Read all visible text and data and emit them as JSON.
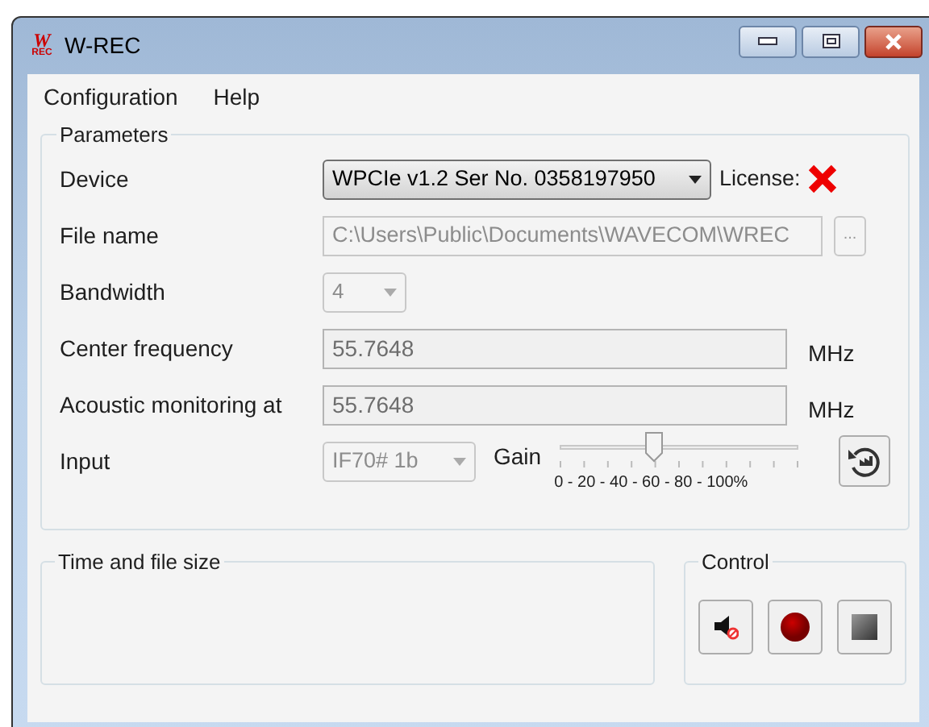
{
  "window": {
    "title": "W-REC",
    "logo": {
      "top": "W",
      "bottom": "REC"
    }
  },
  "menu": [
    {
      "label": "Configuration"
    },
    {
      "label": "Help"
    }
  ],
  "parameters": {
    "title": "Parameters",
    "rows": [
      {
        "kind": "device",
        "label": "Device",
        "value": "WPCIe v1.2 Ser No. 0358197950",
        "license_label": "License:",
        "licensed": false,
        "disabled": false
      },
      {
        "kind": "file",
        "label": "File name",
        "value": "C:\\Users\\Public\\Documents\\WAVECOM\\WREC",
        "browse": "...",
        "disabled": true
      },
      {
        "kind": "combo",
        "label": "Bandwidth",
        "value": "4",
        "disabled": true
      },
      {
        "kind": "number",
        "label": "Center frequency",
        "value": "55.7648",
        "unit": "MHz",
        "disabled": false
      },
      {
        "kind": "number",
        "label": "Acoustic monitoring at",
        "value": "55.7648",
        "unit": "MHz",
        "disabled": false
      },
      {
        "kind": "input",
        "label": "Input",
        "value": "IF70# 1b",
        "disabled": true,
        "gain_label": "Gain",
        "gain": {
          "level": 0.4
        },
        "scale": "0 - 20 - 40 - 60 - 80 - 100%"
      }
    ]
  },
  "time_and_file_size": {
    "title": "Time and file size"
  },
  "control": {
    "title": "Control",
    "buttons": [
      {
        "kind": "mute"
      },
      {
        "kind": "record"
      },
      {
        "kind": "stop"
      }
    ]
  }
}
